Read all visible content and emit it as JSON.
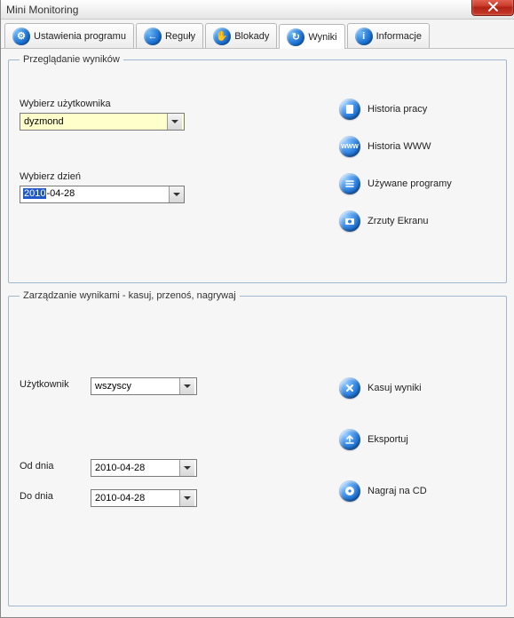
{
  "window": {
    "title": "Mini Monitoring"
  },
  "tabs": [
    {
      "label": "Ustawienia programu",
      "glyph": "⚙"
    },
    {
      "label": "Reguły",
      "glyph": "←"
    },
    {
      "label": "Blokady",
      "glyph": "✋"
    },
    {
      "label": "Wyniki",
      "glyph": "↻"
    },
    {
      "label": "Informacje",
      "glyph": "i"
    }
  ],
  "browse": {
    "legend": "Przeglądanie wyników",
    "user_label": "Wybierz użytkownika",
    "user_value": "dyzmond",
    "day_label": "Wybierz dzień",
    "day_sel": "2010",
    "day_rest": "-04-28",
    "actions": {
      "history_work": "Historia pracy",
      "history_www": "Historia WWW",
      "used_programs": "Używane programy",
      "screenshots": "Zrzuty Ekranu"
    }
  },
  "manage": {
    "legend": "Zarządzanie wynikami - kasuj, przenoś, nagrywaj",
    "user_label": "Użytkownik",
    "user_value": "wszyscy",
    "from_label": "Od dnia",
    "from_value": "2010-04-28",
    "to_label": "Do dnia",
    "to_value": "2010-04-28",
    "actions": {
      "delete": "Kasuj wyniki",
      "export": "Eksportuj",
      "burn": "Nagraj na CD"
    }
  }
}
